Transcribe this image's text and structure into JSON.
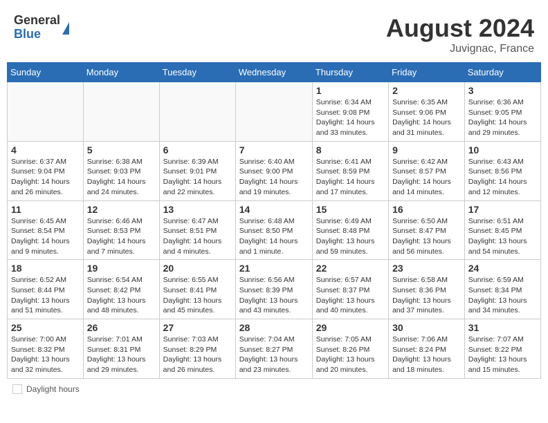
{
  "header": {
    "logo_general": "General",
    "logo_blue": "Blue",
    "month_year": "August 2024",
    "location": "Juvignac, France"
  },
  "footer": {
    "daylight_label": "Daylight hours"
  },
  "weekdays": [
    "Sunday",
    "Monday",
    "Tuesday",
    "Wednesday",
    "Thursday",
    "Friday",
    "Saturday"
  ],
  "weeks": [
    [
      {
        "day": "",
        "info": ""
      },
      {
        "day": "",
        "info": ""
      },
      {
        "day": "",
        "info": ""
      },
      {
        "day": "",
        "info": ""
      },
      {
        "day": "1",
        "info": "Sunrise: 6:34 AM\nSunset: 9:08 PM\nDaylight: 14 hours\nand 33 minutes."
      },
      {
        "day": "2",
        "info": "Sunrise: 6:35 AM\nSunset: 9:06 PM\nDaylight: 14 hours\nand 31 minutes."
      },
      {
        "day": "3",
        "info": "Sunrise: 6:36 AM\nSunset: 9:05 PM\nDaylight: 14 hours\nand 29 minutes."
      }
    ],
    [
      {
        "day": "4",
        "info": "Sunrise: 6:37 AM\nSunset: 9:04 PM\nDaylight: 14 hours\nand 26 minutes."
      },
      {
        "day": "5",
        "info": "Sunrise: 6:38 AM\nSunset: 9:03 PM\nDaylight: 14 hours\nand 24 minutes."
      },
      {
        "day": "6",
        "info": "Sunrise: 6:39 AM\nSunset: 9:01 PM\nDaylight: 14 hours\nand 22 minutes."
      },
      {
        "day": "7",
        "info": "Sunrise: 6:40 AM\nSunset: 9:00 PM\nDaylight: 14 hours\nand 19 minutes."
      },
      {
        "day": "8",
        "info": "Sunrise: 6:41 AM\nSunset: 8:59 PM\nDaylight: 14 hours\nand 17 minutes."
      },
      {
        "day": "9",
        "info": "Sunrise: 6:42 AM\nSunset: 8:57 PM\nDaylight: 14 hours\nand 14 minutes."
      },
      {
        "day": "10",
        "info": "Sunrise: 6:43 AM\nSunset: 8:56 PM\nDaylight: 14 hours\nand 12 minutes."
      }
    ],
    [
      {
        "day": "11",
        "info": "Sunrise: 6:45 AM\nSunset: 8:54 PM\nDaylight: 14 hours\nand 9 minutes."
      },
      {
        "day": "12",
        "info": "Sunrise: 6:46 AM\nSunset: 8:53 PM\nDaylight: 14 hours\nand 7 minutes."
      },
      {
        "day": "13",
        "info": "Sunrise: 6:47 AM\nSunset: 8:51 PM\nDaylight: 14 hours\nand 4 minutes."
      },
      {
        "day": "14",
        "info": "Sunrise: 6:48 AM\nSunset: 8:50 PM\nDaylight: 14 hours\nand 1 minute."
      },
      {
        "day": "15",
        "info": "Sunrise: 6:49 AM\nSunset: 8:48 PM\nDaylight: 13 hours\nand 59 minutes."
      },
      {
        "day": "16",
        "info": "Sunrise: 6:50 AM\nSunset: 8:47 PM\nDaylight: 13 hours\nand 56 minutes."
      },
      {
        "day": "17",
        "info": "Sunrise: 6:51 AM\nSunset: 8:45 PM\nDaylight: 13 hours\nand 54 minutes."
      }
    ],
    [
      {
        "day": "18",
        "info": "Sunrise: 6:52 AM\nSunset: 8:44 PM\nDaylight: 13 hours\nand 51 minutes."
      },
      {
        "day": "19",
        "info": "Sunrise: 6:54 AM\nSunset: 8:42 PM\nDaylight: 13 hours\nand 48 minutes."
      },
      {
        "day": "20",
        "info": "Sunrise: 6:55 AM\nSunset: 8:41 PM\nDaylight: 13 hours\nand 45 minutes."
      },
      {
        "day": "21",
        "info": "Sunrise: 6:56 AM\nSunset: 8:39 PM\nDaylight: 13 hours\nand 43 minutes."
      },
      {
        "day": "22",
        "info": "Sunrise: 6:57 AM\nSunset: 8:37 PM\nDaylight: 13 hours\nand 40 minutes."
      },
      {
        "day": "23",
        "info": "Sunrise: 6:58 AM\nSunset: 8:36 PM\nDaylight: 13 hours\nand 37 minutes."
      },
      {
        "day": "24",
        "info": "Sunrise: 6:59 AM\nSunset: 8:34 PM\nDaylight: 13 hours\nand 34 minutes."
      }
    ],
    [
      {
        "day": "25",
        "info": "Sunrise: 7:00 AM\nSunset: 8:32 PM\nDaylight: 13 hours\nand 32 minutes."
      },
      {
        "day": "26",
        "info": "Sunrise: 7:01 AM\nSunset: 8:31 PM\nDaylight: 13 hours\nand 29 minutes."
      },
      {
        "day": "27",
        "info": "Sunrise: 7:03 AM\nSunset: 8:29 PM\nDaylight: 13 hours\nand 26 minutes."
      },
      {
        "day": "28",
        "info": "Sunrise: 7:04 AM\nSunset: 8:27 PM\nDaylight: 13 hours\nand 23 minutes."
      },
      {
        "day": "29",
        "info": "Sunrise: 7:05 AM\nSunset: 8:26 PM\nDaylight: 13 hours\nand 20 minutes."
      },
      {
        "day": "30",
        "info": "Sunrise: 7:06 AM\nSunset: 8:24 PM\nDaylight: 13 hours\nand 18 minutes."
      },
      {
        "day": "31",
        "info": "Sunrise: 7:07 AM\nSunset: 8:22 PM\nDaylight: 13 hours\nand 15 minutes."
      }
    ]
  ]
}
